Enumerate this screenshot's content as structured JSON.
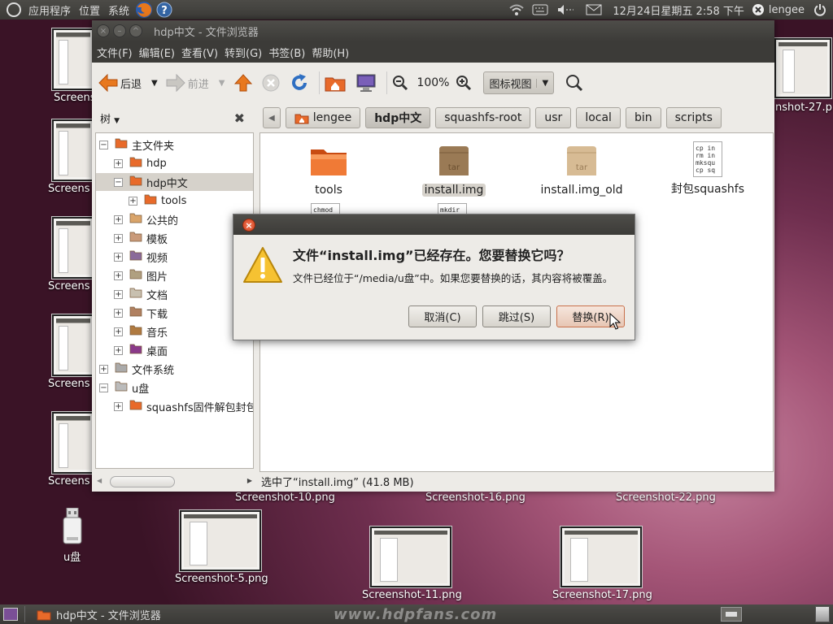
{
  "top_panel": {
    "menus": [
      "应用程序",
      "位置",
      "系统"
    ],
    "datetime": "12月24日星期五 2:58 下午",
    "user": "lengee"
  },
  "desktop": {
    "left_labels": [
      "Screens",
      "Screens",
      "Screens",
      "Screens",
      "Screens"
    ],
    "top_right_label": "nshot-27.p",
    "usb_label": "u盘",
    "row1_labels": [
      "Screenshot-10.png",
      "Screenshot-16.png",
      "Screenshot-22.png"
    ],
    "row2_labels": [
      "Screenshot-5.png",
      "Screenshot-11.png",
      "Screenshot-17.png"
    ],
    "watermark": "www.hdpfans.com"
  },
  "window": {
    "title": "hdp中文 - 文件浏览器",
    "menus": [
      "文件(F)",
      "编辑(E)",
      "查看(V)",
      "转到(G)",
      "书签(B)",
      "帮助(H)"
    ],
    "toolbar": {
      "back": "后退",
      "forward": "前进",
      "zoom": "100%",
      "view_mode": "图标视图"
    },
    "sidebar_title": "树",
    "breadcrumbs": [
      "lengee",
      "hdp中文",
      "squashfs-root",
      "usr",
      "local",
      "bin",
      "scripts"
    ],
    "tree": [
      {
        "label": "主文件夹",
        "level": 0,
        "expander": "−"
      },
      {
        "label": "hdp",
        "level": 1,
        "expander": "+"
      },
      {
        "label": "hdp中文",
        "level": 1,
        "expander": "−"
      },
      {
        "label": "tools",
        "level": 2,
        "expander": "+"
      },
      {
        "label": "公共的",
        "level": 1,
        "expander": "+"
      },
      {
        "label": "模板",
        "level": 1,
        "expander": "+"
      },
      {
        "label": "视频",
        "level": 1,
        "expander": "+"
      },
      {
        "label": "图片",
        "level": 1,
        "expander": "+"
      },
      {
        "label": "文档",
        "level": 1,
        "expander": "+"
      },
      {
        "label": "下载",
        "level": 1,
        "expander": "+"
      },
      {
        "label": "音乐",
        "level": 1,
        "expander": "+"
      },
      {
        "label": "桌面",
        "level": 1,
        "expander": "+"
      },
      {
        "label": "文件系统",
        "level": 0,
        "expander": "+"
      },
      {
        "label": "u盘",
        "level": 0,
        "expander": "−"
      },
      {
        "label": "squashfs固件解包封包",
        "level": 1,
        "expander": "+"
      }
    ],
    "files": [
      {
        "name": "tools",
        "icon": "folder-icon"
      },
      {
        "name": "install.img",
        "icon": "tar-archive-icon"
      },
      {
        "name": "install.img_old",
        "icon": "tar-archive-icon"
      },
      {
        "name": "封包squashfs",
        "icon": "script-file-icon",
        "preview": [
          "cp in",
          "rm in",
          "mksqu",
          "cp sq"
        ]
      }
    ],
    "partial_files": [
      {
        "preview": "chmod"
      },
      {
        "preview": "mkdir"
      }
    ],
    "status": "选中了“install.img” (41.8 MB)"
  },
  "dialog": {
    "heading": "文件“install.img”已经存在。您要替换它吗？",
    "message": "文件已经位于“/media/u盘”中。如果您要替换的话，其内容将被覆盖。",
    "buttons": {
      "cancel": "取消(C)",
      "skip": "跳过(S)",
      "replace": "替换(R)"
    }
  },
  "taskbar": {
    "task": "hdp中文 - 文件浏览器"
  },
  "colors": {
    "accent_orange": "#e8591e",
    "panel_dark": "#3c3b38",
    "selection": "#d6d2cb"
  }
}
